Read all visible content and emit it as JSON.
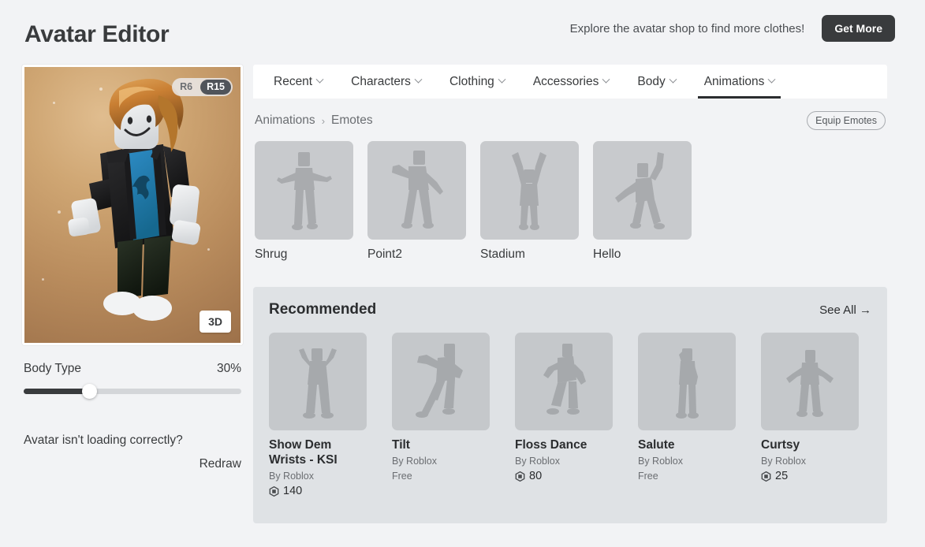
{
  "header": {
    "title": "Avatar Editor",
    "shop_blurb": "Explore the avatar shop to find more clothes!",
    "get_more_label": "Get More"
  },
  "avatar_panel": {
    "rig_options": [
      {
        "label": "R6",
        "active": false
      },
      {
        "label": "R15",
        "active": true
      }
    ],
    "view_badge": "3D",
    "body_type_label": "Body Type",
    "body_type_value": "30%",
    "body_type_percent": 30,
    "loading_note": "Avatar isn't loading correctly?",
    "redraw_label": "Redraw",
    "background_color": "#c09a6b"
  },
  "tabs": [
    {
      "label": "Recent",
      "active": false
    },
    {
      "label": "Characters",
      "active": false
    },
    {
      "label": "Clothing",
      "active": false
    },
    {
      "label": "Accessories",
      "active": false
    },
    {
      "label": "Body",
      "active": false
    },
    {
      "label": "Animations",
      "active": true
    }
  ],
  "breadcrumb": {
    "root": "Animations",
    "separator": "›",
    "current": "Emotes",
    "equip_label": "Equip Emotes"
  },
  "emotes": [
    {
      "name": "Shrug"
    },
    {
      "name": "Point2"
    },
    {
      "name": "Stadium"
    },
    {
      "name": "Hello"
    }
  ],
  "recommended": {
    "title": "Recommended",
    "see_all_label": "See All →",
    "items": [
      {
        "name": "Show Dem Wrists - KSI",
        "by": "By  Roblox",
        "price": "140",
        "free": ""
      },
      {
        "name": "Tilt",
        "by": "By  Roblox",
        "price": "",
        "free": "Free"
      },
      {
        "name": "Floss Dance",
        "by": "By  Roblox",
        "price": "80",
        "free": ""
      },
      {
        "name": "Salute",
        "by": "By  Roblox",
        "price": "",
        "free": "Free"
      },
      {
        "name": "Curtsy",
        "by": "By  Roblox",
        "price": "25",
        "free": ""
      }
    ]
  },
  "colors": {
    "page_bg": "#f2f3f5",
    "panel_bg": "#dfe2e5",
    "thumb_bg": "#c8cacd",
    "accent_dark": "#393b3d"
  }
}
